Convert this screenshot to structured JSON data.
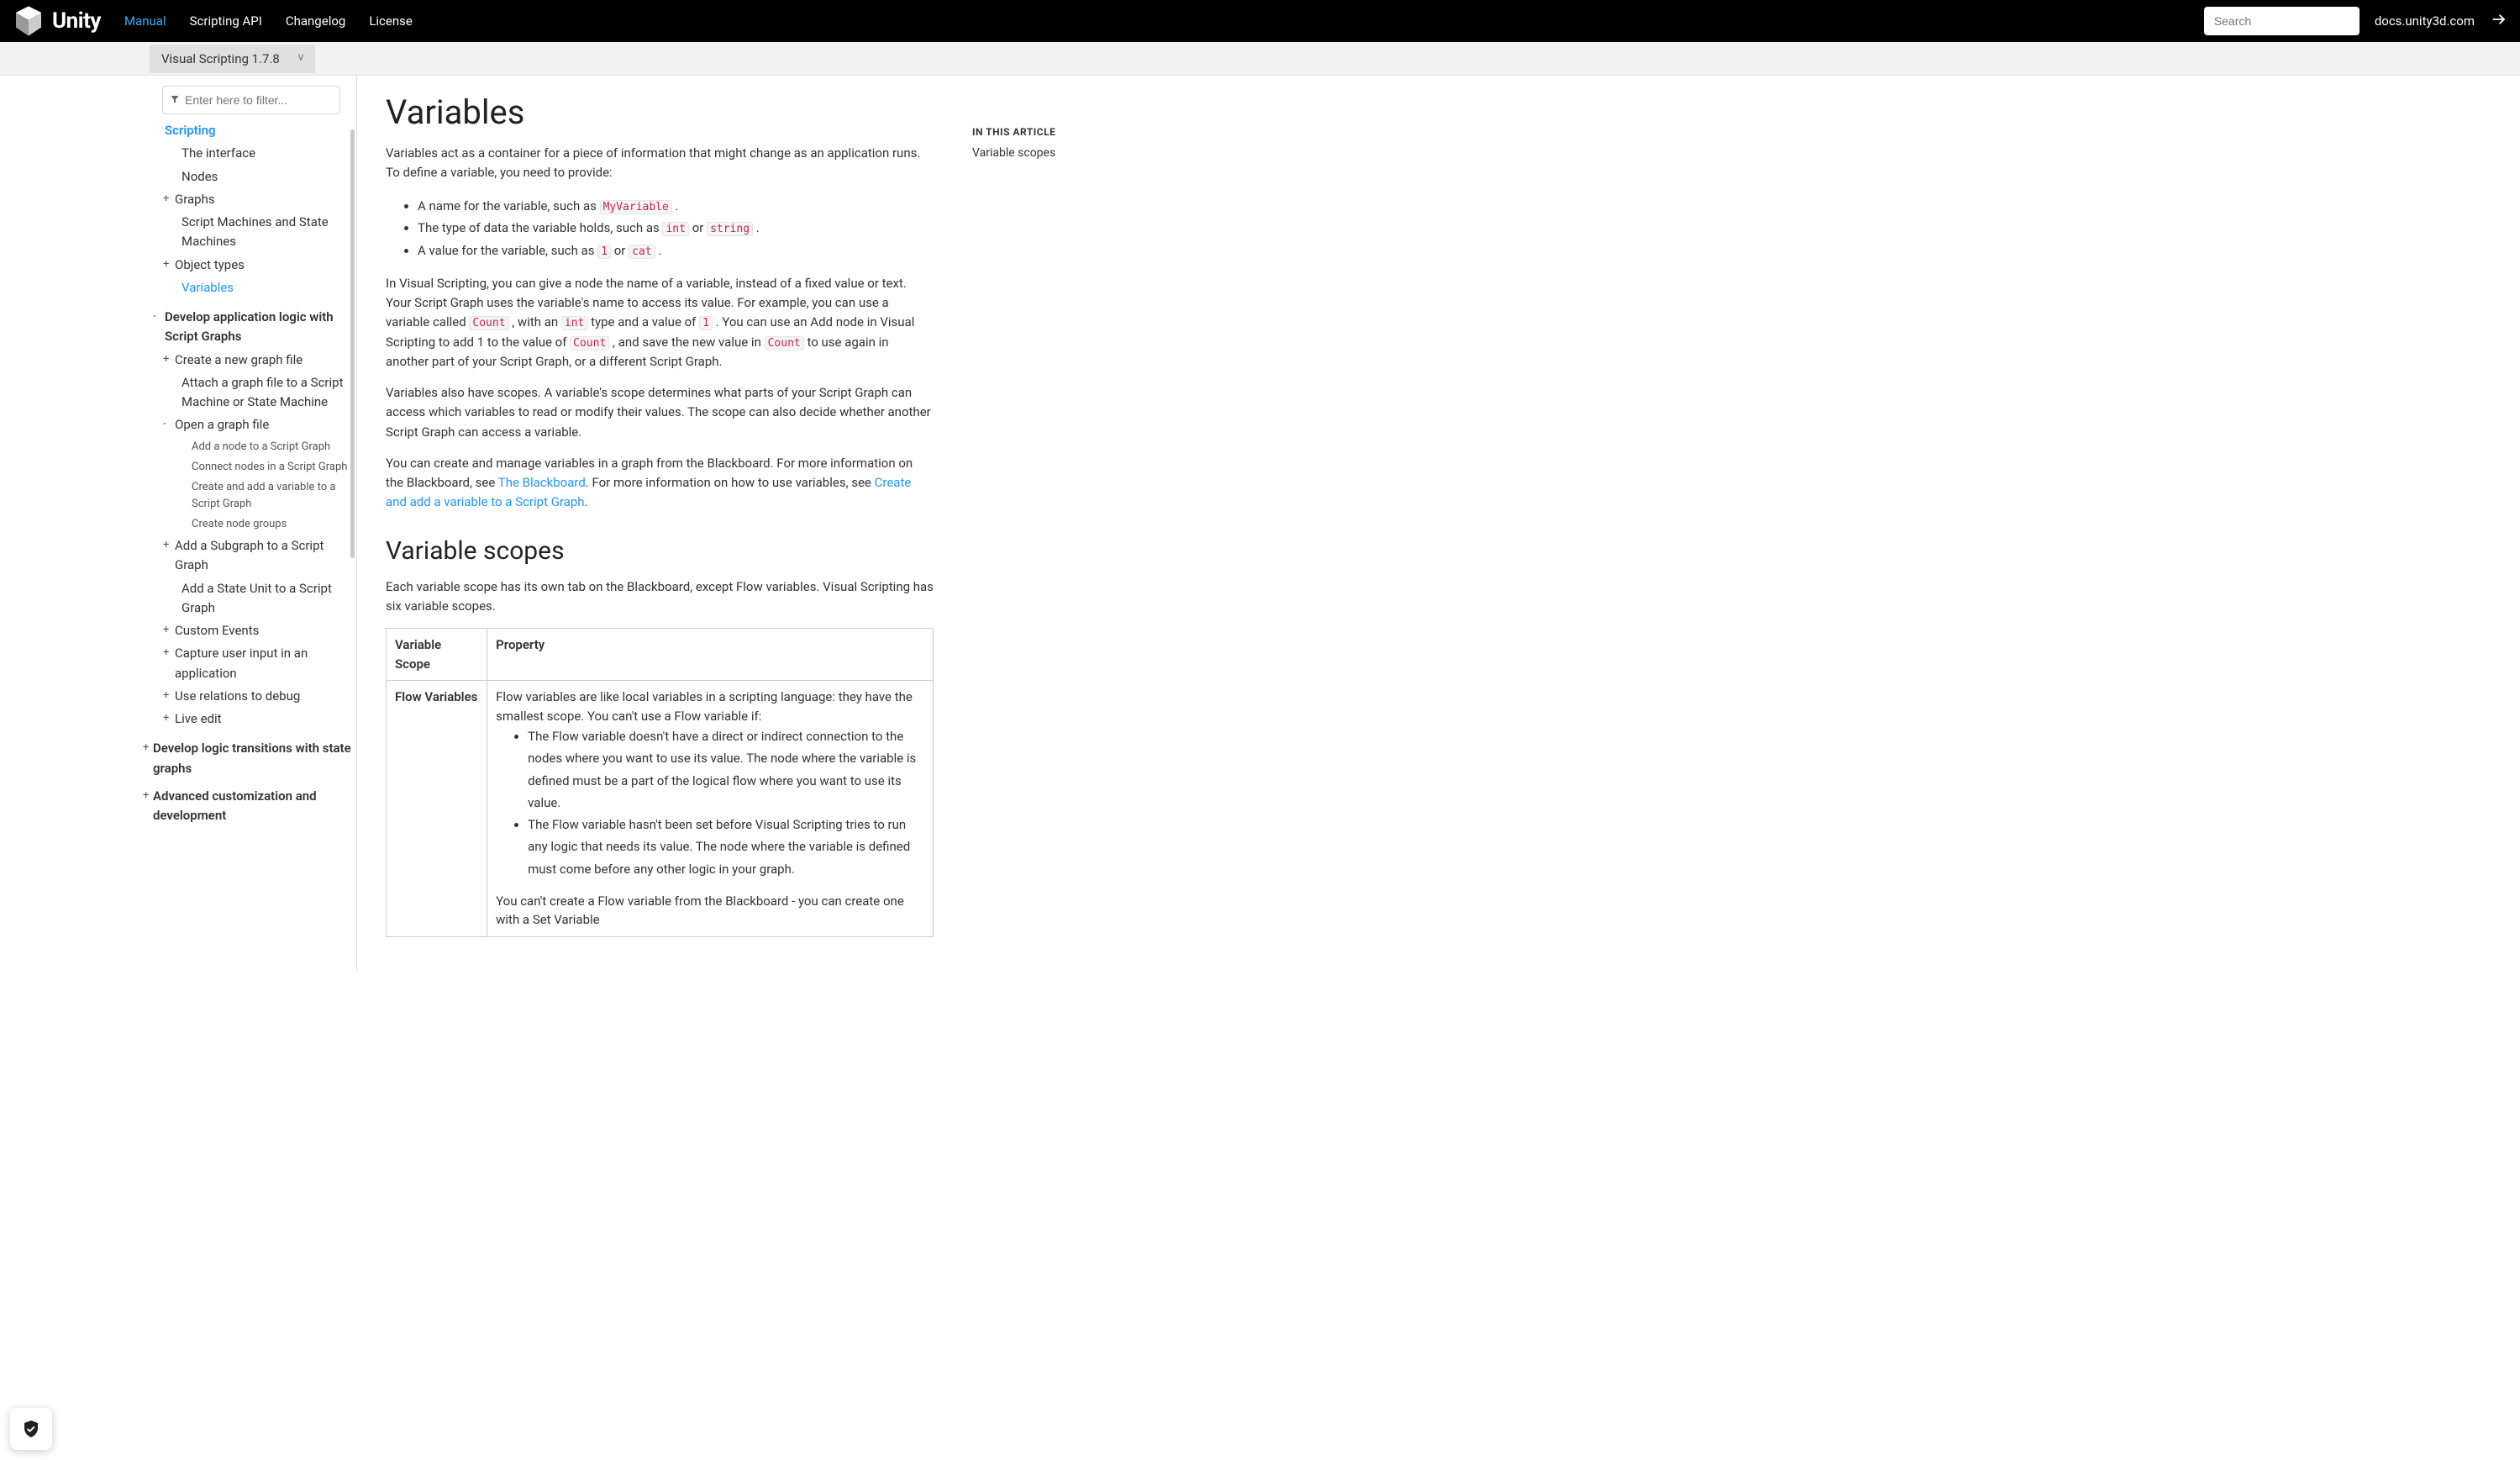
{
  "header": {
    "brand": "Unity",
    "nav": {
      "manual": "Manual",
      "scripting_api": "Scripting API",
      "changelog": "Changelog",
      "license": "License"
    },
    "search_placeholder": "Search",
    "docs_link": "docs.unity3d.com"
  },
  "version": {
    "label": "Visual Scripting 1.7.8"
  },
  "sidebar": {
    "filter_placeholder": "Enter here to filter...",
    "items": {
      "scripting": "Scripting",
      "interface": "The interface",
      "nodes": "Nodes",
      "graphs": "Graphs",
      "script_machines": "Script Machines and State Machines",
      "object_types": "Object types",
      "variables": "Variables",
      "develop_app": "Develop application logic with Script Graphs",
      "create_graph": "Create a new graph file",
      "attach_graph": "Attach a graph file to a Script Machine or State Machine",
      "open_graph": "Open a graph file",
      "add_node": "Add a node to a Script Graph",
      "connect_nodes": "Connect nodes in a Script Graph",
      "create_variable": "Create and add a variable to a Script Graph",
      "create_groups": "Create node groups",
      "add_subgraph": "Add a Subgraph to a Script Graph",
      "add_state_unit": "Add a State Unit to a Script Graph",
      "custom_events": "Custom Events",
      "capture_input": "Capture user input in an application",
      "use_relations": "Use relations to debug",
      "live_edit": "Live edit",
      "develop_logic": "Develop logic transitions with state graphs",
      "advanced": "Advanced customization and development"
    }
  },
  "article": {
    "title": "Variables",
    "intro": "Variables act as a container for a piece of information that might change as an application runs. To define a variable, you need to provide:",
    "bullets_intro": {
      "b1_a": "A name for the variable, such as ",
      "b1_code": "MyVariable",
      "b1_c": " .",
      "b2_a": "The type of data the variable holds, such as ",
      "b2_code1": "int",
      "b2_b": " or ",
      "b2_code2": "string",
      "b2_c": " .",
      "b3_a": "A value for the variable, such as ",
      "b3_code1": "1",
      "b3_b": " or ",
      "b3_code2": "cat",
      "b3_c": " ."
    },
    "p2_a": "In Visual Scripting, you can give a node the name of a variable, instead of a fixed value or text. Your Script Graph uses the variable's name to access its value. For example, you can use a variable called ",
    "p2_code1": "Count",
    "p2_b": " , with an ",
    "p2_code2": "int",
    "p2_c": " type and a value of ",
    "p2_code3": "1",
    "p2_d": " . You can use an Add node in Visual Scripting to add 1 to the value of ",
    "p2_code4": "Count",
    "p2_e": " , and save the new value in ",
    "p2_code5": "Count",
    "p2_f": " to use again in another part of your Script Graph, or a different Script Graph.",
    "p3": "Variables also have scopes. A variable's scope determines what parts of your Script Graph can access which variables to read or modify their values. The scope can also decide whether another Script Graph can access a variable.",
    "p4_a": "You can create and manage variables in a graph from the Blackboard. For more information on the Blackboard, see ",
    "p4_link1": "The Blackboard",
    "p4_b": ". For more information on how to use variables, see ",
    "p4_link2": "Create and add a variable to a Script Graph",
    "p4_c": ".",
    "h2": "Variable scopes",
    "p5": "Each variable scope has its own tab on the Blackboard, except Flow variables. Visual Scripting has six variable scopes.",
    "table": {
      "col1": "Variable Scope",
      "col2": "Property",
      "row1_scope": "Flow Variables",
      "row1_p1": "Flow variables are like local variables in a scripting language: they have the smallest scope. You can't use a Flow variable if:",
      "row1_li1": "The Flow variable doesn't have a direct or indirect connection to the nodes where you want to use its value. The node where the variable is defined must be a part of the logical flow where you want to use its value.",
      "row1_li2": "The Flow variable hasn't been set before Visual Scripting tries to run any logic that needs its value. The node where the variable is defined must come before any other logic in your graph.",
      "row1_p2": "You can't create a Flow variable from the Blackboard - you can create one with a Set Variable"
    }
  },
  "right": {
    "heading": "IN THIS ARTICLE",
    "link1": "Variable scopes"
  }
}
